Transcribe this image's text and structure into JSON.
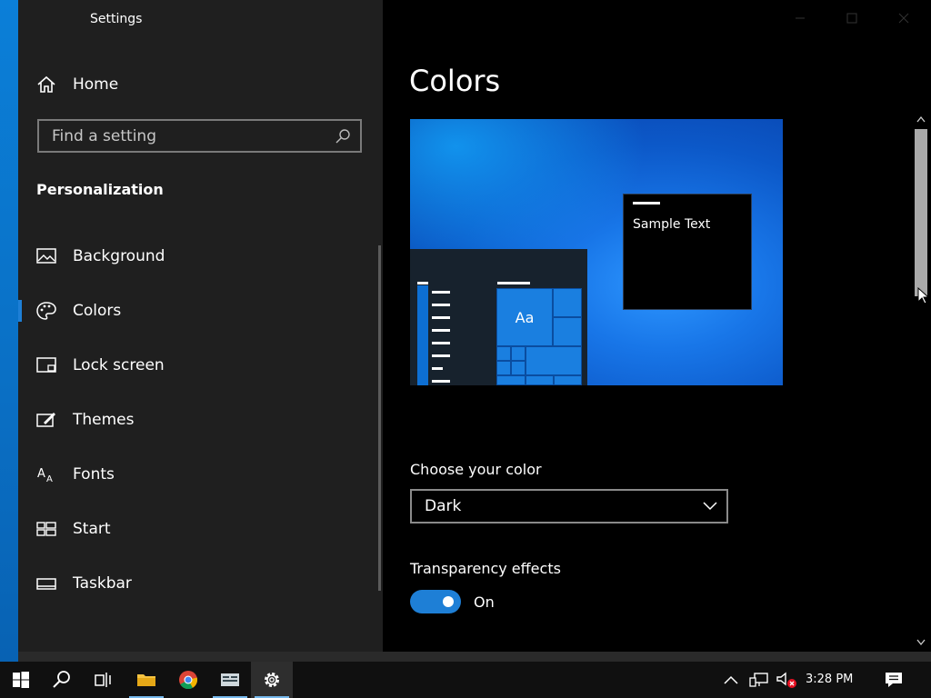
{
  "window": {
    "title": "Settings"
  },
  "sidebar": {
    "home_label": "Home",
    "search_placeholder": "Find a setting",
    "section_title": "Personalization",
    "items": [
      {
        "label": "Background",
        "icon": "picture-icon",
        "selected": false
      },
      {
        "label": "Colors",
        "icon": "palette-icon",
        "selected": true
      },
      {
        "label": "Lock screen",
        "icon": "lock-screen-icon",
        "selected": false
      },
      {
        "label": "Themes",
        "icon": "themes-icon",
        "selected": false
      },
      {
        "label": "Fonts",
        "icon": "fonts-icon",
        "selected": false
      },
      {
        "label": "Start",
        "icon": "start-icon",
        "selected": false
      },
      {
        "label": "Taskbar",
        "icon": "taskbar-icon",
        "selected": false
      }
    ]
  },
  "main": {
    "title": "Colors",
    "preview": {
      "sample_text": "Sample Text",
      "tile_text": "Aa"
    },
    "choose_color_label": "Choose your color",
    "choose_color_value": "Dark",
    "transparency_label": "Transparency effects",
    "transparency_state": "On"
  },
  "taskbar": {
    "time": "3:28 PM",
    "apps": [
      "start-icon",
      "search-icon",
      "task-view-icon",
      "file-explorer-icon",
      "chrome-icon",
      "app-icon",
      "settings-gear-icon"
    ]
  },
  "colors": {
    "accent": "#1e7fd6",
    "sidebar_bg": "#1f1f1f",
    "content_bg": "#000000"
  }
}
